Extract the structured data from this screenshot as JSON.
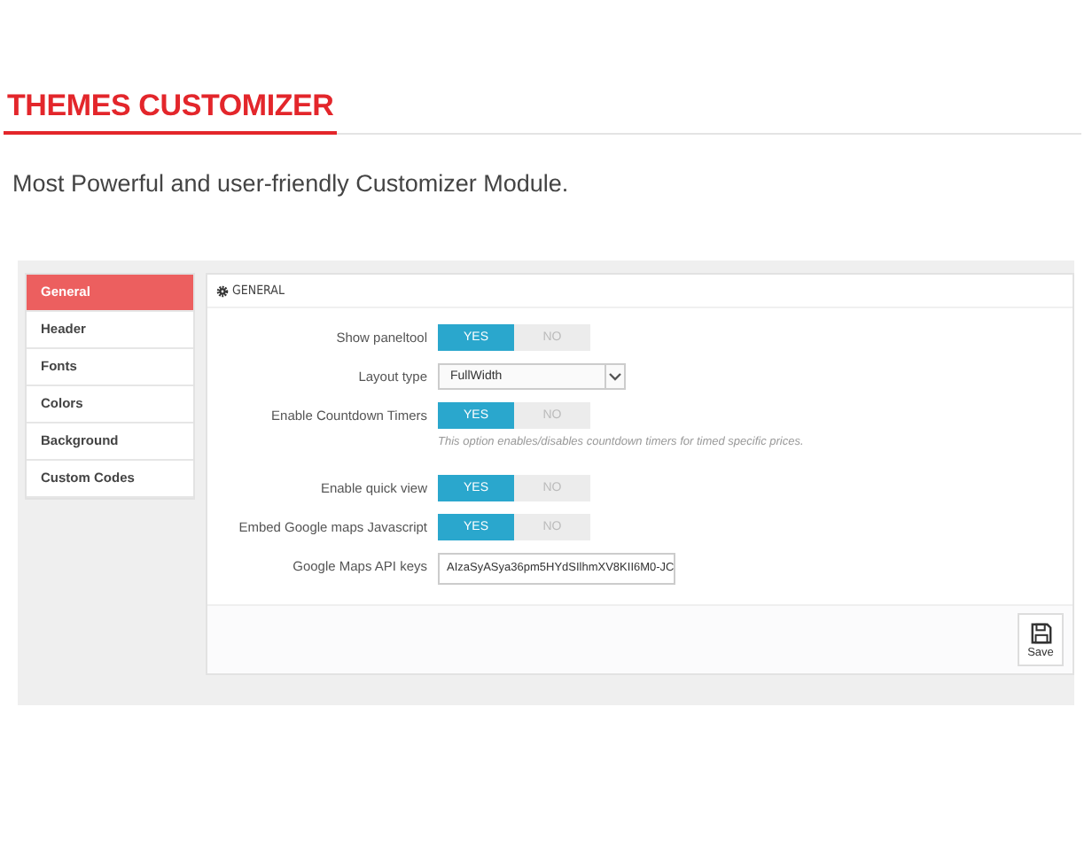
{
  "heading": "THEMES CUSTOMIZER",
  "subtitle": "Most Powerful and user-friendly Customizer Module.",
  "sidebar": {
    "items": [
      {
        "label": "General",
        "selected": true
      },
      {
        "label": "Header",
        "selected": false
      },
      {
        "label": "Fonts",
        "selected": false
      },
      {
        "label": "Colors",
        "selected": false
      },
      {
        "label": "Background",
        "selected": false
      },
      {
        "label": "Custom Codes",
        "selected": false
      }
    ]
  },
  "panel": {
    "title": "GENERAL",
    "rows": [
      {
        "kind": "toggle",
        "label": "Show paneltool",
        "yes": "YES",
        "no": "NO",
        "on": true
      },
      {
        "kind": "select",
        "label": "Layout type",
        "value": "FullWidth"
      },
      {
        "kind": "toggle",
        "label": "Enable Countdown Timers",
        "yes": "YES",
        "no": "NO",
        "on": true,
        "help": "This option enables/disables countdown timers for timed specific prices."
      },
      {
        "kind": "toggle",
        "label": "Enable quick view",
        "yes": "YES",
        "no": "NO",
        "on": true
      },
      {
        "kind": "toggle",
        "label": "Embed Google maps Javascript",
        "yes": "YES",
        "no": "NO",
        "on": true
      },
      {
        "kind": "text",
        "label": "Google Maps API keys",
        "value": "AIzaSyASya36pm5HYdSIlhmXV8KII6M0-JC"
      }
    ],
    "save_button": "Save"
  }
}
